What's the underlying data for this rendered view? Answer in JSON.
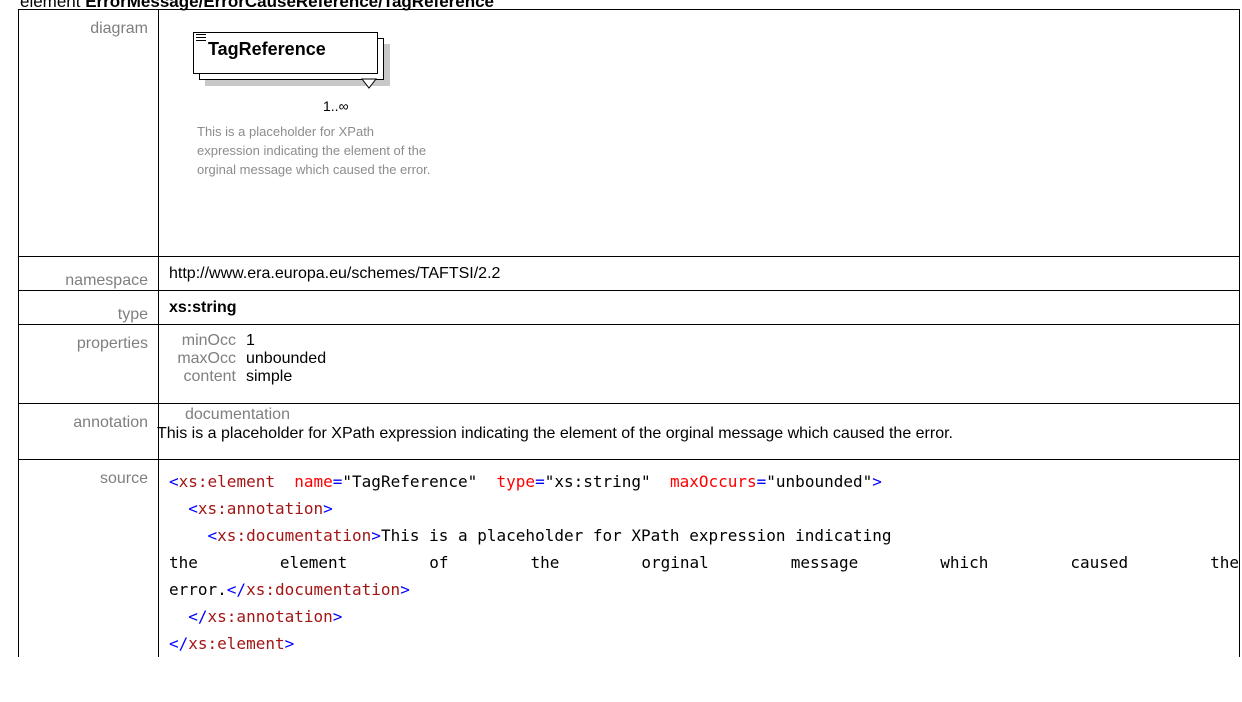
{
  "heading": {
    "prefix": "element ",
    "path": "ErrorMessage/ErrorCauseReference/TagReference"
  },
  "rows": {
    "diagram": {
      "label": "diagram",
      "element_name": "TagReference",
      "cardinality": "1..∞",
      "doc": "This is a placeholder for XPath expression indicating the element of the orginal message which caused the error."
    },
    "namespace": {
      "label": "namespace",
      "value": "http://www.era.europa.eu/schemes/TAFTSI/2.2"
    },
    "type": {
      "label": "type",
      "value": "xs:string"
    },
    "properties": {
      "label": "properties",
      "items": [
        {
          "key": "minOcc",
          "value": "1"
        },
        {
          "key": "maxOcc",
          "value": "unbounded"
        },
        {
          "key": "content",
          "value": "simple"
        }
      ]
    },
    "annotation": {
      "label": "annotation",
      "header": "documentation",
      "text": "This is a placeholder for XPath expression indicating the element of the orginal message which caused the error."
    },
    "source": {
      "label": "source",
      "open_tag": "xs:element",
      "attr1": "name",
      "val1": "\"TagReference\"",
      "attr2": "type",
      "val2": "\"xs:string\"",
      "attr3": "maxOccurs",
      "val3": "\"unbounded\"",
      "annotation_tag": "xs:annotation",
      "doc_tag": "xs:documentation",
      "doc_line1": "This is a placeholder for XPath expression indicating",
      "doc_line2": "the element of the orginal message which caused the",
      "doc_line3": "error."
    }
  }
}
